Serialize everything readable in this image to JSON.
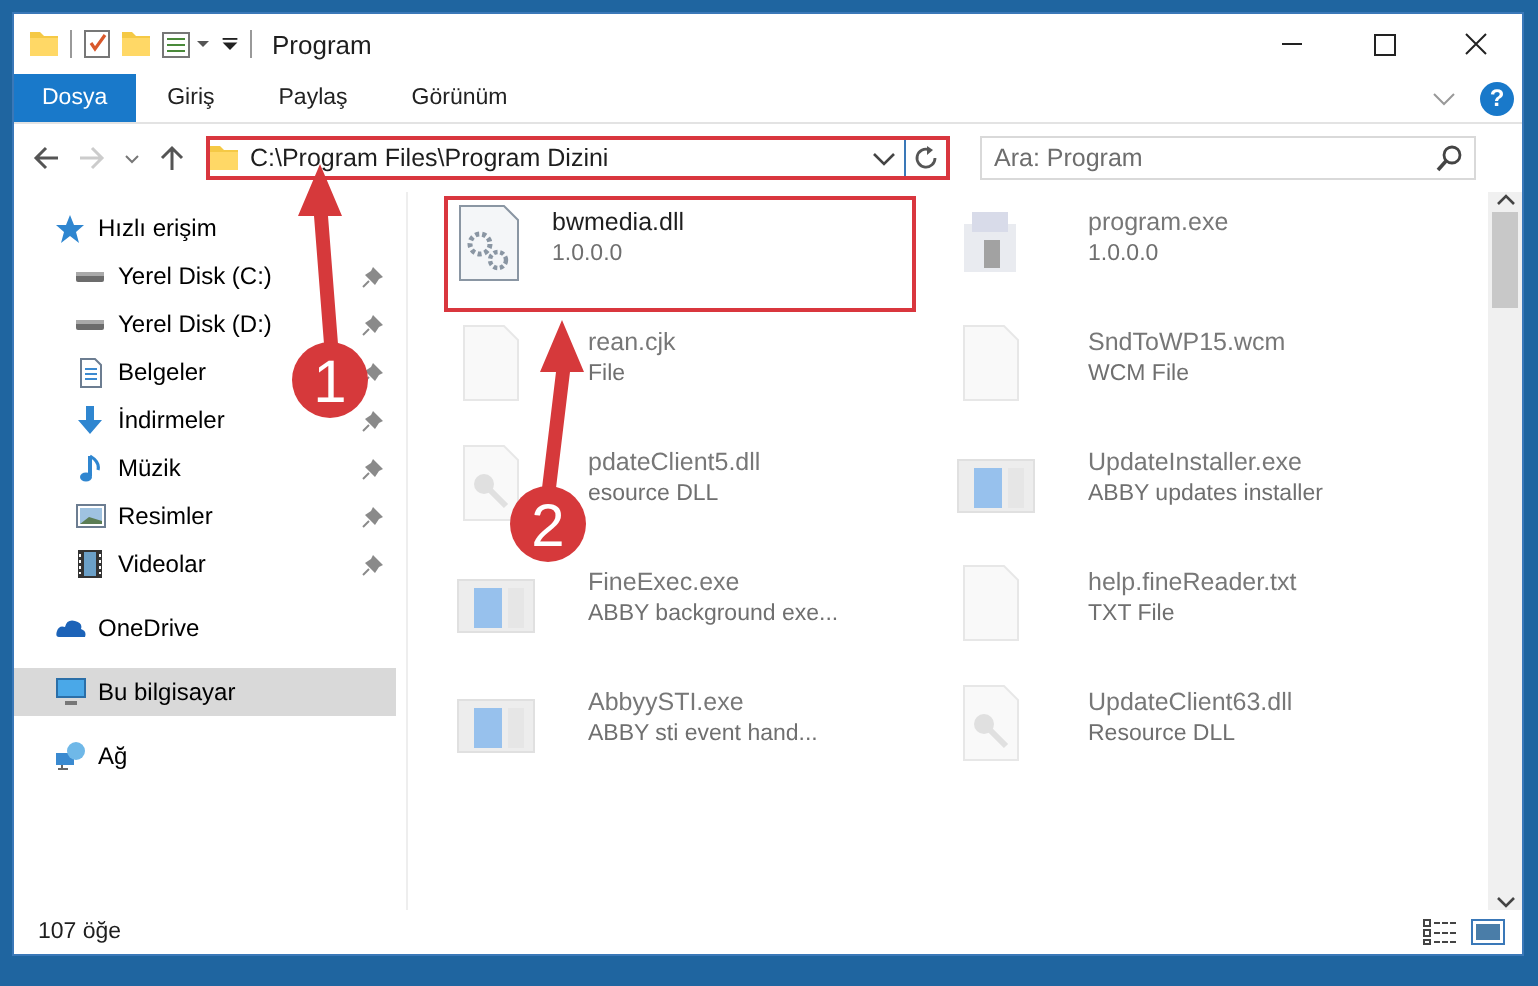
{
  "window": {
    "title": "Program"
  },
  "ribbon": {
    "tabs": [
      {
        "label": "Dosya",
        "selected": true
      },
      {
        "label": "Giriş",
        "selected": false
      },
      {
        "label": "Paylaş",
        "selected": false
      },
      {
        "label": "Görünüm",
        "selected": false
      }
    ],
    "help": "?"
  },
  "address": {
    "value": "C:\\Program Files\\Program Dizini",
    "highlighted": true
  },
  "search": {
    "placeholder": "Ara: Program"
  },
  "sidebar": {
    "items": [
      {
        "label": "Hızlı erişim",
        "kind": "star",
        "selected": false,
        "children": [
          {
            "label": "Yerel Disk (C:)",
            "kind": "drive",
            "pinned": true,
            "selected": false
          },
          {
            "label": "Yerel Disk (D:)",
            "kind": "drive",
            "pinned": true,
            "selected": false
          },
          {
            "label": "Belgeler",
            "kind": "document",
            "pinned": true,
            "selected": false
          },
          {
            "label": "İndirmeler",
            "kind": "download",
            "pinned": true,
            "selected": false
          },
          {
            "label": "Müzik",
            "kind": "music",
            "pinned": true,
            "selected": false
          },
          {
            "label": "Resimler",
            "kind": "image",
            "pinned": true,
            "selected": false
          },
          {
            "label": "Videolar",
            "kind": "film",
            "pinned": true,
            "selected": false
          }
        ]
      },
      {
        "label": "OneDrive",
        "kind": "cloud",
        "selected": false
      },
      {
        "label": "Bu bilgisayar",
        "kind": "monitor",
        "selected": true
      },
      {
        "label": "Ağ",
        "kind": "network",
        "selected": false
      }
    ]
  },
  "files": [
    {
      "name": "bwmedia.dll",
      "detail": "1.0.0.0",
      "kind": "gears",
      "highlighted": true
    },
    {
      "name": "program.exe",
      "detail": "1.0.0.0",
      "kind": "program",
      "highlighted": false
    },
    {
      "name": "rean.cjk",
      "detail": "File",
      "kind": "blank",
      "highlighted": false
    },
    {
      "name": "SndToWP15.wcm",
      "detail": "WCM File",
      "kind": "blank",
      "highlighted": false
    },
    {
      "name": "pdateClient5.dll",
      "detail": "esource DLL",
      "kind": "key",
      "highlighted": false
    },
    {
      "name": "UpdateInstaller.exe",
      "detail": "ABBY updates installer",
      "kind": "window",
      "highlighted": false
    },
    {
      "name": "FineExec.exe",
      "detail": "ABBY background exe...",
      "kind": "window",
      "highlighted": false
    },
    {
      "name": "help.fineReader.txt",
      "detail": "TXT File",
      "kind": "blank",
      "highlighted": false
    },
    {
      "name": "AbbyySTI.exe",
      "detail": "ABBY sti event hand...",
      "kind": "window",
      "highlighted": false
    },
    {
      "name": "UpdateClient63.dll",
      "detail": "Resource DLL",
      "kind": "key",
      "highlighted": false
    }
  ],
  "status_bar": {
    "count": "107 öğe"
  },
  "callouts": [
    {
      "number": "1"
    },
    {
      "number": "2"
    }
  ]
}
